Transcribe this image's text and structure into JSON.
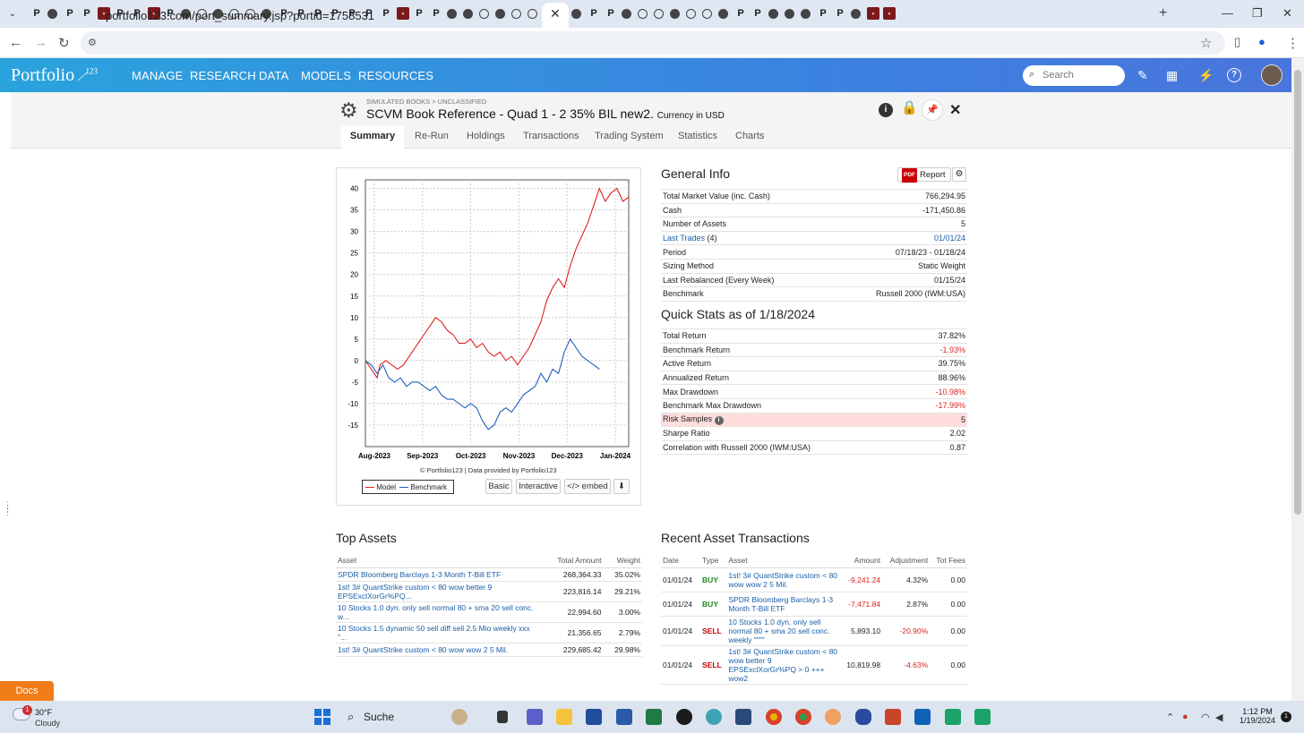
{
  "browser": {
    "url": "portfolio123.com/port_summary.jsp?portid=1758531",
    "tab_favicons": [
      "P",
      "P",
      "P",
      "P",
      "P",
      "P",
      "P",
      "P",
      "P",
      "P",
      "P",
      "P",
      "P",
      "P",
      "P",
      "P",
      "P",
      "P"
    ]
  },
  "app": {
    "logo_text": "Portfolio",
    "logo_sup": "123",
    "nav": [
      "MANAGE",
      "RESEARCH",
      "DATA",
      "MODELS",
      "RESOURCES"
    ],
    "search_placeholder": "Search"
  },
  "book": {
    "breadcrumb": "SIMULATED BOOKS > UNCLASSIFIED",
    "title": "SCVM Book Reference - Quad 1 - 2 35% BIL new2.",
    "currency": "Currency in USD",
    "tabs": [
      "Summary",
      "Re-Run",
      "Holdings",
      "Transactions",
      "Trading System",
      "Statistics",
      "Charts"
    ]
  },
  "chart": {
    "copyright": "© Portfolio123 | Data provided by Portfolio123",
    "legend_model": "Model",
    "legend_benchmark": "Benchmark",
    "buttons": [
      "Basic",
      "Interactive",
      "</> embed"
    ]
  },
  "chart_data": {
    "type": "line",
    "title": "",
    "xlabel": "",
    "ylabel": "",
    "x_ticks": [
      "Aug-2023",
      "Sep-2023",
      "Oct-2023",
      "Nov-2023",
      "Dec-2023",
      "Jan-2024"
    ],
    "ylim": [
      -20,
      42
    ],
    "y_ticks": [
      40,
      35,
      30,
      25,
      20,
      15,
      10,
      5,
      0,
      -5,
      -10,
      -15
    ],
    "grid": true,
    "series": [
      {
        "name": "Model",
        "color": "#e02020",
        "points": [
          [
            0,
            0
          ],
          [
            4,
            -2
          ],
          [
            8,
            -4
          ],
          [
            10,
            -1
          ],
          [
            14,
            0
          ],
          [
            18,
            -1
          ],
          [
            22,
            -2
          ],
          [
            26,
            -1
          ],
          [
            30,
            1
          ],
          [
            36,
            4
          ],
          [
            40,
            6
          ],
          [
            44,
            8
          ],
          [
            48,
            10
          ],
          [
            52,
            9
          ],
          [
            56,
            7
          ],
          [
            60,
            6
          ],
          [
            64,
            4
          ],
          [
            68,
            4
          ],
          [
            72,
            5
          ],
          [
            76,
            3
          ],
          [
            80,
            4
          ],
          [
            84,
            2
          ],
          [
            88,
            1
          ],
          [
            92,
            2
          ],
          [
            96,
            0
          ],
          [
            100,
            1
          ],
          [
            104,
            -1
          ],
          [
            108,
            1
          ],
          [
            112,
            3
          ],
          [
            116,
            6
          ],
          [
            120,
            9
          ],
          [
            124,
            14
          ],
          [
            128,
            17
          ],
          [
            132,
            19
          ],
          [
            136,
            17
          ],
          [
            140,
            22
          ],
          [
            144,
            26
          ],
          [
            148,
            29
          ],
          [
            152,
            32
          ],
          [
            156,
            36
          ],
          [
            160,
            40
          ],
          [
            164,
            37
          ],
          [
            168,
            39
          ],
          [
            172,
            40
          ],
          [
            176,
            37
          ],
          [
            180,
            38
          ]
        ]
      },
      {
        "name": "Benchmark",
        "color": "#2060c0",
        "points": [
          [
            0,
            0
          ],
          [
            4,
            -1
          ],
          [
            8,
            -3
          ],
          [
            12,
            -1
          ],
          [
            16,
            -4
          ],
          [
            20,
            -5
          ],
          [
            24,
            -4
          ],
          [
            28,
            -6
          ],
          [
            32,
            -5
          ],
          [
            36,
            -5
          ],
          [
            40,
            -6
          ],
          [
            44,
            -7
          ],
          [
            48,
            -6
          ],
          [
            52,
            -8
          ],
          [
            56,
            -9
          ],
          [
            60,
            -9
          ],
          [
            64,
            -10
          ],
          [
            68,
            -11
          ],
          [
            72,
            -10
          ],
          [
            76,
            -11
          ],
          [
            80,
            -14
          ],
          [
            84,
            -16
          ],
          [
            88,
            -15
          ],
          [
            92,
            -12
          ],
          [
            96,
            -11
          ],
          [
            100,
            -12
          ],
          [
            104,
            -10
          ],
          [
            108,
            -8
          ],
          [
            112,
            -7
          ],
          [
            116,
            -6
          ],
          [
            120,
            -3
          ],
          [
            124,
            -5
          ],
          [
            128,
            -2
          ],
          [
            132,
            -3
          ],
          [
            136,
            2
          ],
          [
            140,
            5
          ],
          [
            144,
            3
          ],
          [
            148,
            1
          ],
          [
            152,
            0
          ],
          [
            156,
            -1
          ],
          [
            160,
            -2
          ]
        ]
      }
    ]
  },
  "general_info": {
    "title": "General Info",
    "report_label": "Report",
    "pdf_label": "PDF",
    "rows": [
      {
        "label": "Total Market Value (inc. Cash)",
        "value": "766,294.95"
      },
      {
        "label": "Cash",
        "value": "-171,450.86"
      },
      {
        "label": "Number of Assets",
        "value": "5"
      },
      {
        "label": "Last Trades",
        "label_suffix": " (4)",
        "value": "01/01/24",
        "link": true
      },
      {
        "label": "Period",
        "value": "07/18/23 - 01/18/24"
      },
      {
        "label": "Sizing Method",
        "value": "Static Weight"
      },
      {
        "label": "Last Rebalanced (Every Week)",
        "value": "01/15/24"
      },
      {
        "label": "Benchmark",
        "value": "Russell 2000 (IWM:USA)"
      }
    ]
  },
  "quick_stats": {
    "title": "Quick Stats as of 1/18/2024",
    "rows": [
      {
        "label": "Total Return",
        "value": "37.82%"
      },
      {
        "label": "Benchmark Return",
        "value": "-1.93%",
        "neg": true
      },
      {
        "label": "Active Return",
        "value": "39.75%"
      },
      {
        "label": "Annualized Return",
        "value": "88.96%"
      },
      {
        "label": "Max Drawdown",
        "value": "-10.98%",
        "neg": true
      },
      {
        "label": "Benchmark Max Drawdown",
        "value": "-17.99%",
        "neg": true
      },
      {
        "label": "Risk Samples",
        "value": "5",
        "highlight": true
      },
      {
        "label": "Sharpe Ratio",
        "value": "2.02"
      },
      {
        "label": "Correlation with Russell 2000 (IWM:USA)",
        "value": "0.87"
      }
    ]
  },
  "top_assets": {
    "title": "Top Assets",
    "columns": [
      "Asset",
      "Total Amount",
      "Weight"
    ],
    "rows": [
      [
        "SPDR Bloomberg Barclays 1-3 Month T-Bill ETF",
        "268,364.33",
        "35.02%"
      ],
      [
        "1st! 3# QuantStrike custom < 80 wow better 9 EPSExclXorGr%PQ...",
        "223,816.14",
        "29.21%"
      ],
      [
        "10 Stocks 1.0 dyn. only sell normal 80 + sma 20 sell conc. w...",
        "22,994.60",
        "3.00%"
      ],
      [
        "10 Stocks 1.5 dynamic 50 sell diff sell 2.5 Mio weekly xxx \"...",
        "21,356.65",
        "2.79%"
      ],
      [
        "1st! 3# QuantStrike custom < 80 wow wow 2 5 Mil.",
        "229,685.42",
        "29.98%"
      ]
    ]
  },
  "recent_tx": {
    "title": "Recent Asset Transactions",
    "columns": [
      "Date",
      "Type",
      "Asset",
      "Amount",
      "Adjustment",
      "Tot Fees"
    ],
    "rows": [
      [
        "01/01/24",
        "BUY",
        "1st! 3# QuantStrike custom < 80 wow wow 2 5 Mil.",
        "-9,241.24",
        "4.32%",
        "0.00"
      ],
      [
        "01/01/24",
        "BUY",
        "SPDR Bloomberg Barclays 1-3 Month T-Bill ETF",
        "-7,471.84",
        "2.87%",
        "0.00"
      ],
      [
        "01/01/24",
        "SELL",
        "10 Stocks 1.0 dyn. only sell normal 80 + sma 20 sell conc. weekly \"\"\"\"",
        "5,893.10",
        "-20.90%",
        "0.00"
      ],
      [
        "01/01/24",
        "SELL",
        "1st! 3# QuantStrike custom < 80 wow better 9 EPSExclXorGr%PQ > 0 +++ wow2",
        "10,819.98",
        "-4.63%",
        "0.00"
      ]
    ]
  },
  "docs_label": "Docs",
  "taskbar": {
    "temp": "30°F",
    "condition": "Cloudy",
    "weather_badge": "1",
    "search": "Suche",
    "time": "1:12 PM",
    "date": "1/19/2024",
    "notif": "1"
  }
}
